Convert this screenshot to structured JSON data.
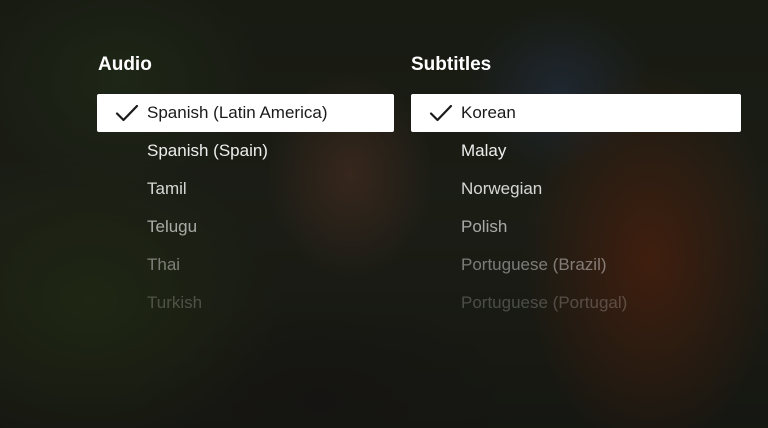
{
  "audio": {
    "title": "Audio",
    "items": [
      {
        "label": "Spanish (Latin America)",
        "selected": true
      },
      {
        "label": "Spanish (Spain)",
        "selected": false
      },
      {
        "label": "Tamil",
        "selected": false
      },
      {
        "label": "Telugu",
        "selected": false
      },
      {
        "label": "Thai",
        "selected": false
      },
      {
        "label": "Turkish",
        "selected": false
      }
    ]
  },
  "subtitles": {
    "title": "Subtitles",
    "items": [
      {
        "label": "Korean",
        "selected": true
      },
      {
        "label": "Malay",
        "selected": false
      },
      {
        "label": "Norwegian",
        "selected": false
      },
      {
        "label": "Polish",
        "selected": false
      },
      {
        "label": "Portuguese (Brazil)",
        "selected": false
      },
      {
        "label": "Portuguese (Portugal)",
        "selected": false
      }
    ]
  },
  "colors": {
    "selected_bg": "#ffffff",
    "selected_text": "#1a1a1a",
    "text": "#ffffff"
  },
  "icons": {
    "check": "checkmark-icon"
  }
}
